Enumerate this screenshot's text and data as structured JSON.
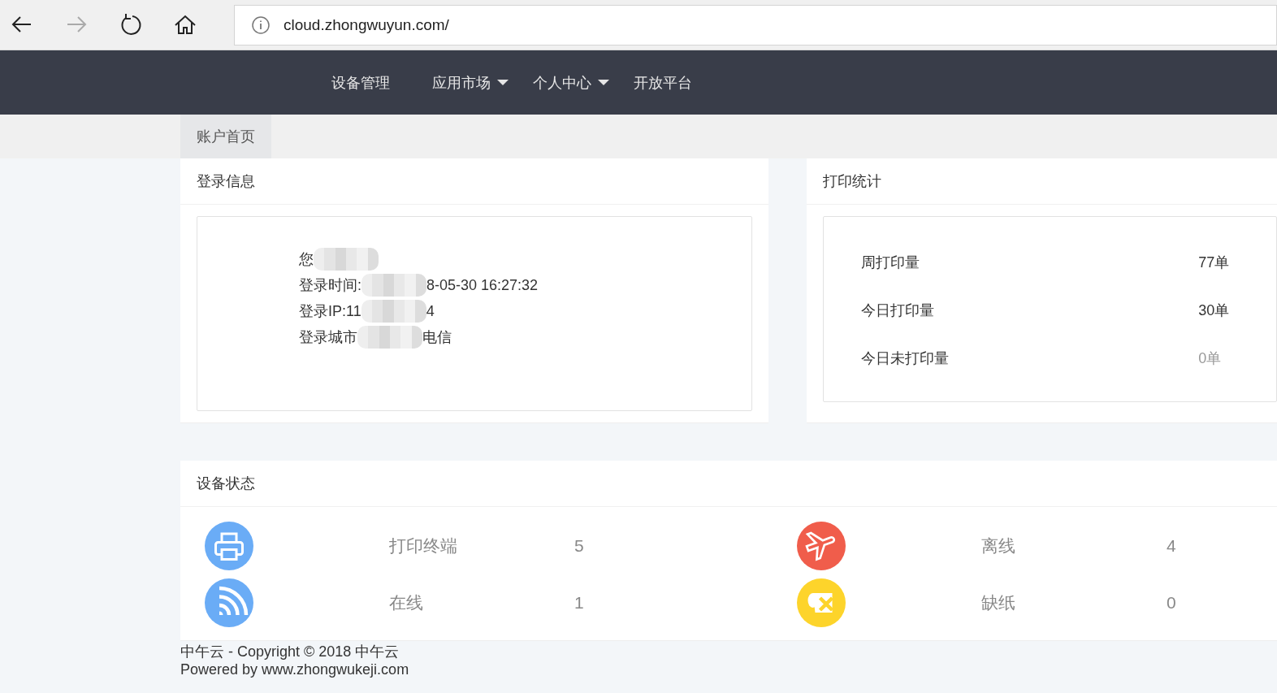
{
  "browser": {
    "url": "cloud.zhongwuyun.com/"
  },
  "nav": {
    "items": [
      {
        "label": "设备管理",
        "dropdown": false
      },
      {
        "label": "应用市场",
        "dropdown": true
      },
      {
        "label": "个人中心",
        "dropdown": true
      },
      {
        "label": "开放平台",
        "dropdown": false
      }
    ]
  },
  "breadcrumb": {
    "tabs": [
      {
        "label": "账户首页",
        "selected": true
      }
    ]
  },
  "login_info": {
    "title": "登录信息",
    "lines": [
      {
        "parts": [
          "您"
        ],
        "redacted": true
      },
      {
        "parts": [
          "登录时间:",
          "8-05-30 16:27:32"
        ],
        "redacted": false
      },
      {
        "parts": [
          "登录IP:11",
          "4"
        ],
        "redacted": false
      },
      {
        "parts": [
          "登录城市",
          "电信"
        ],
        "redacted": false
      }
    ]
  },
  "print_stats": {
    "title": "打印统计",
    "rows": [
      {
        "label": "周打印量",
        "value": "77单",
        "muted": false
      },
      {
        "label": "今日打印量",
        "value": "30单",
        "muted": false
      },
      {
        "label": "今日未打印量",
        "value": "0单",
        "muted": true
      }
    ]
  },
  "device_status": {
    "title": "设备状态",
    "items": [
      {
        "kind": "printer",
        "label": "打印终端",
        "value": "5",
        "color": "#6aacf6"
      },
      {
        "kind": "offline",
        "label": "离线",
        "value": "4",
        "color": "#f05d4b"
      },
      {
        "kind": "online",
        "label": "在线",
        "value": "1",
        "color": "#6aacf6"
      },
      {
        "kind": "nopaper",
        "label": "缺纸",
        "value": "0",
        "color": "#fdd42b"
      }
    ]
  },
  "footer": {
    "lines": [
      "中午云 - Copyright © 2018 中午云",
      "Powered by www.zhongwukeji.com"
    ]
  }
}
